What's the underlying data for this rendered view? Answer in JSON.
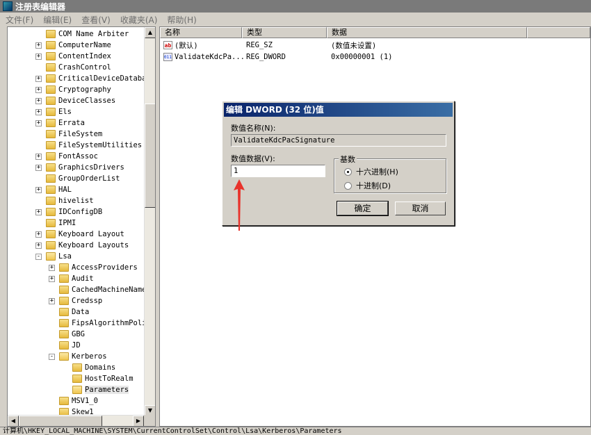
{
  "window": {
    "title": "注册表编辑器"
  },
  "menu": [
    "文件(F)",
    "编辑(E)",
    "查看(V)",
    "收藏夹(A)",
    "帮助(H)"
  ],
  "tree": [
    {
      "label": "COM Name Arbiter",
      "indent": 0,
      "exp": ""
    },
    {
      "label": "ComputerName",
      "indent": 0,
      "exp": "+"
    },
    {
      "label": "ContentIndex",
      "indent": 0,
      "exp": "+"
    },
    {
      "label": "CrashControl",
      "indent": 0,
      "exp": ""
    },
    {
      "label": "CriticalDeviceDataba",
      "indent": 0,
      "exp": "+"
    },
    {
      "label": "Cryptography",
      "indent": 0,
      "exp": "+"
    },
    {
      "label": "DeviceClasses",
      "indent": 0,
      "exp": "+"
    },
    {
      "label": "Els",
      "indent": 0,
      "exp": "+"
    },
    {
      "label": "Errata",
      "indent": 0,
      "exp": "+"
    },
    {
      "label": "FileSystem",
      "indent": 0,
      "exp": ""
    },
    {
      "label": "FileSystemUtilities",
      "indent": 0,
      "exp": ""
    },
    {
      "label": "FontAssoc",
      "indent": 0,
      "exp": "+"
    },
    {
      "label": "GraphicsDrivers",
      "indent": 0,
      "exp": "+"
    },
    {
      "label": "GroupOrderList",
      "indent": 0,
      "exp": ""
    },
    {
      "label": "HAL",
      "indent": 0,
      "exp": "+"
    },
    {
      "label": "hivelist",
      "indent": 0,
      "exp": ""
    },
    {
      "label": "IDConfigDB",
      "indent": 0,
      "exp": "+"
    },
    {
      "label": "IPMI",
      "indent": 0,
      "exp": ""
    },
    {
      "label": "Keyboard Layout",
      "indent": 0,
      "exp": "+"
    },
    {
      "label": "Keyboard Layouts",
      "indent": 0,
      "exp": "+"
    },
    {
      "label": "Lsa",
      "indent": 0,
      "exp": "-"
    },
    {
      "label": "AccessProviders",
      "indent": 1,
      "exp": "+"
    },
    {
      "label": "Audit",
      "indent": 1,
      "exp": "+"
    },
    {
      "label": "CachedMachineName",
      "indent": 1,
      "exp": ""
    },
    {
      "label": "Credssp",
      "indent": 1,
      "exp": "+"
    },
    {
      "label": "Data",
      "indent": 1,
      "exp": ""
    },
    {
      "label": "FipsAlgorithmPoli",
      "indent": 1,
      "exp": ""
    },
    {
      "label": "GBG",
      "indent": 1,
      "exp": ""
    },
    {
      "label": "JD",
      "indent": 1,
      "exp": ""
    },
    {
      "label": "Kerberos",
      "indent": 1,
      "exp": "-"
    },
    {
      "label": "Domains",
      "indent": 2,
      "exp": ""
    },
    {
      "label": "HostToRealm",
      "indent": 2,
      "exp": ""
    },
    {
      "label": "Parameters",
      "indent": 2,
      "exp": "",
      "selected": true
    },
    {
      "label": "MSV1_0",
      "indent": 1,
      "exp": ""
    },
    {
      "label": "Skew1",
      "indent": 1,
      "exp": ""
    }
  ],
  "list": {
    "columns": [
      "名称",
      "类型",
      "数据"
    ],
    "rows": [
      {
        "icon": "string-value-icon",
        "glyph": "ab",
        "name": "(默认)",
        "type": "REG_SZ",
        "data": "(数值未设置)"
      },
      {
        "icon": "dword-value-icon",
        "glyph": "011\n110",
        "name": "ValidateKdcPa...",
        "type": "REG_DWORD",
        "data": "0x00000001 (1)"
      }
    ]
  },
  "dialog": {
    "title": "编辑 DWORD (32 位)值",
    "name_label": "数值名称(N):",
    "name_value": "ValidateKdcPacSignature",
    "data_label": "数值数据(V):",
    "data_value": "1",
    "base_label": "基数",
    "hex_label": "十六进制(H)",
    "dec_label": "十进制(D)",
    "hex_selected": true,
    "ok_label": "确定",
    "cancel_label": "取消"
  },
  "status": "计算机\\HKEY_LOCAL_MACHINE\\SYSTEM\\CurrentControlSet\\Control\\Lsa\\Kerberos\\Parameters",
  "colors": {
    "title_gradient_start": "#0a246a",
    "title_gradient_end": "#3a6ea5",
    "arrow": "#e8322b"
  }
}
